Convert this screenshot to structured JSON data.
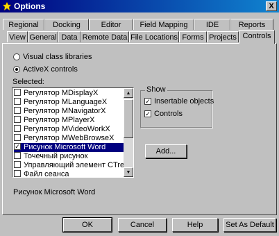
{
  "window": {
    "title": "Options",
    "close": "X"
  },
  "tabs_row1": [
    "Regional",
    "Docking",
    "Editor",
    "Field Mapping",
    "IDE",
    "Reports"
  ],
  "tabs_row2": [
    "View",
    "General",
    "Data",
    "Remote Data",
    "File Locations",
    "Forms",
    "Projects",
    "Controls"
  ],
  "radio": {
    "visual_class": "Visual class libraries",
    "activex": "ActiveX controls"
  },
  "selected_label": "Selected:",
  "list_items": [
    {
      "label": "Регулятор MDisplayX",
      "checked": false
    },
    {
      "label": "Регулятор MLanguageX",
      "checked": false
    },
    {
      "label": "Регулятор MNavigatorX",
      "checked": false
    },
    {
      "label": "Регулятор MPlayerX",
      "checked": false
    },
    {
      "label": "Регулятор MVideoWorkX",
      "checked": false
    },
    {
      "label": "Регулятор MWebBrowseX",
      "checked": false
    },
    {
      "label": "Рисунок Microsoft Word",
      "checked": true,
      "selected": true
    },
    {
      "label": "Точечный рисунок",
      "checked": false
    },
    {
      "label": "Управляющий элемент CTreeView",
      "checked": false
    },
    {
      "label": "Файл сеанса",
      "checked": false
    }
  ],
  "show": {
    "title": "Show",
    "insertable": "Insertable objects",
    "controls": "Controls",
    "insertable_checked": true,
    "controls_checked": true
  },
  "add_button": "Add...",
  "status_text": "Рисунок Microsoft Word",
  "buttons": {
    "ok": "OK",
    "cancel": "Cancel",
    "help": "Help",
    "set_default": "Set As Default"
  }
}
